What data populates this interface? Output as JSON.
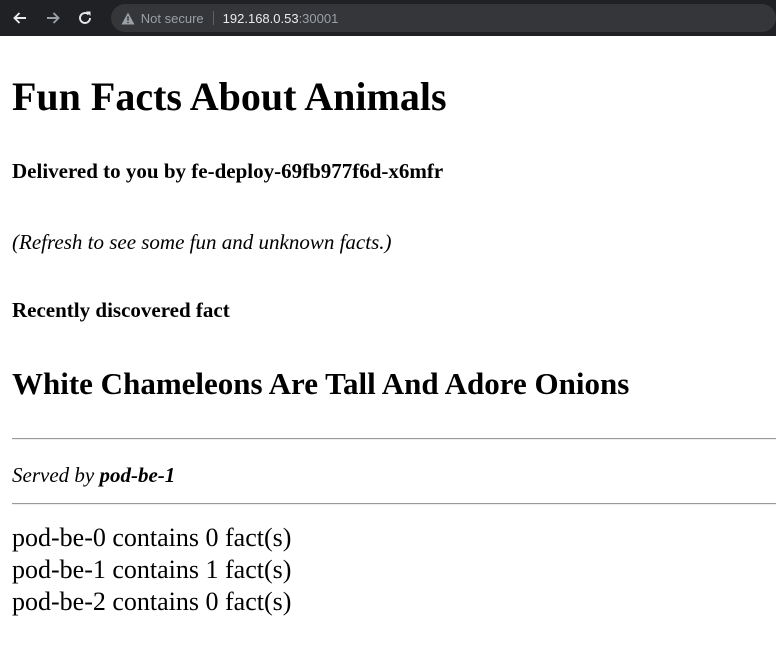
{
  "browser": {
    "security_label": "Not secure",
    "url_host": "192.168.0.53",
    "url_port": ":30001"
  },
  "page": {
    "title": "Fun Facts About Animals",
    "delivered_by": "Delivered to you by fe-deploy-69fb977f6d-x6mfr",
    "refresh_hint": "(Refresh to see some fun and unknown facts.)",
    "recent_label": "Recently discovered fact",
    "fact": "White Chameleons Are Tall And Adore Onions",
    "served_prefix": "Served by ",
    "served_pod": "pod-be-1",
    "pod_counts": [
      "pod-be-0 contains 0 fact(s)",
      "pod-be-1 contains 1 fact(s)",
      "pod-be-2 contains 0 fact(s)"
    ]
  },
  "colors": {
    "toolbar_bg": "#202124",
    "omnibox_bg": "#35363a",
    "icon": "#e8eaed",
    "icon_disabled": "#9aa0a6"
  }
}
